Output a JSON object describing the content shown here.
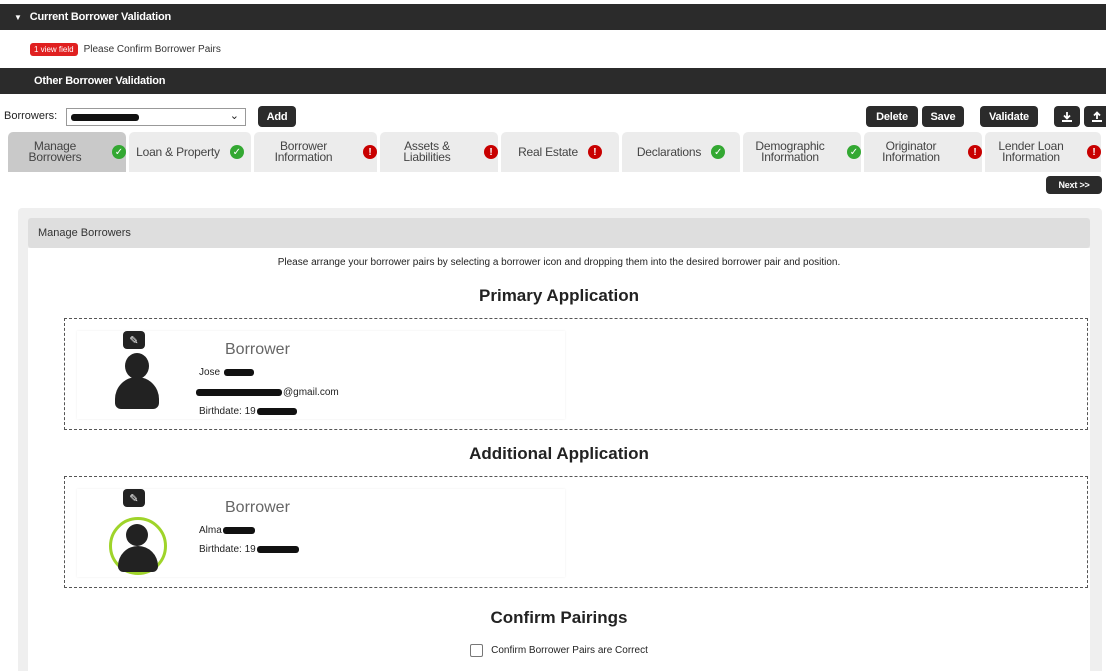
{
  "header": {
    "current_validation_title": "Current Borrower Validation",
    "error_badge": "1 view field",
    "validation_message": "Please Confirm Borrower Pairs",
    "other_validation_title": "Other Borrower Validation"
  },
  "toolbar": {
    "borrowers_label": "Borrowers:",
    "add_label": "Add",
    "delete_label": "Delete",
    "save_label": "Save",
    "validate_label": "Validate",
    "download_icon": "download-icon",
    "upload_icon": "upload-icon"
  },
  "tabs": [
    {
      "label": "Manage Borrowers",
      "status": "ok"
    },
    {
      "label": "Loan & Property",
      "status": "ok"
    },
    {
      "label": "Borrower Information",
      "status": "error"
    },
    {
      "label": "Assets & Liabilities",
      "status": "error"
    },
    {
      "label": "Real Estate",
      "status": "error"
    },
    {
      "label": "Declarations",
      "status": "ok"
    },
    {
      "label": "Demographic Information",
      "status": "ok"
    },
    {
      "label": "Originator Information",
      "status": "error"
    },
    {
      "label": "Lender Loan Information",
      "status": "error"
    }
  ],
  "next_label": "Next >>",
  "panel": {
    "header": "Manage Borrowers",
    "instructions": "Please arrange your borrower pairs by selecting a borrower icon and dropping them into the desired borrower pair and position.",
    "primary_title": "Primary Application",
    "additional_title": "Additional Application",
    "confirm_title": "Confirm Pairings",
    "confirm_label": "Confirm Borrower Pairs are Correct"
  },
  "primary_borrower": {
    "role": "Borrower",
    "name_prefix": "Jose",
    "email_suffix": "@gmail.com",
    "birthdate_prefix": "Birthdate: 19"
  },
  "additional_borrower": {
    "role": "Borrower",
    "name_prefix": "Alma",
    "birthdate_prefix": "Birthdate: 19"
  },
  "colors": {
    "header_bar": "#2b2b2b",
    "ok": "#33a832",
    "error": "#c80000",
    "selection_ring": "#9fd42a"
  }
}
